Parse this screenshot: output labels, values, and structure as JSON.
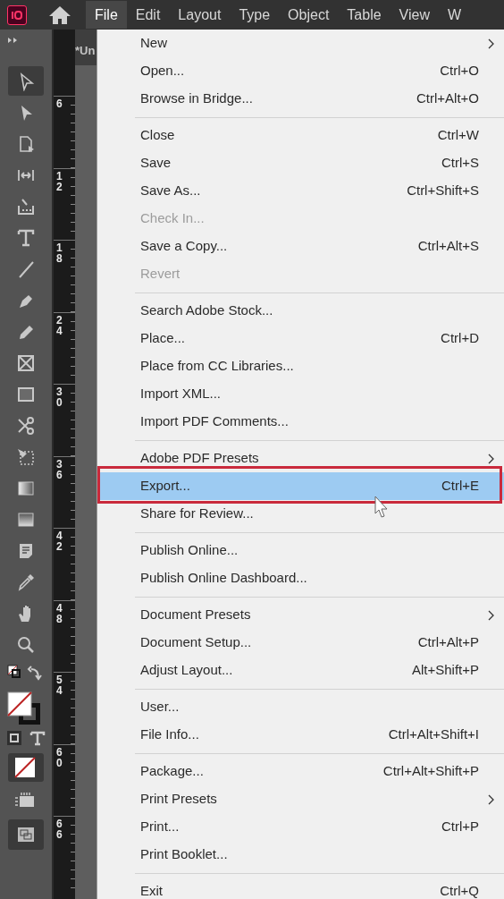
{
  "menubar": {
    "items": [
      {
        "label": "File",
        "selected": true
      },
      {
        "label": "Edit",
        "selected": false
      },
      {
        "label": "Layout",
        "selected": false
      },
      {
        "label": "Type",
        "selected": false
      },
      {
        "label": "Object",
        "selected": false
      },
      {
        "label": "Table",
        "selected": false
      },
      {
        "label": "View",
        "selected": false
      },
      {
        "label": "W",
        "selected": false
      }
    ]
  },
  "document_tab": {
    "title": "*Un"
  },
  "toolbar": {
    "tools": [
      {
        "kind": "selection",
        "selected": true
      },
      {
        "kind": "direct",
        "selected": false
      },
      {
        "kind": "page",
        "selected": false
      },
      {
        "kind": "gap",
        "selected": false
      },
      {
        "kind": "collector",
        "selected": false
      },
      {
        "kind": "type",
        "selected": false
      },
      {
        "kind": "line",
        "selected": false
      },
      {
        "kind": "pen",
        "selected": false
      },
      {
        "kind": "pencil",
        "selected": false
      },
      {
        "kind": "rectframe",
        "selected": false
      },
      {
        "kind": "rectangle",
        "selected": false
      },
      {
        "kind": "scissors",
        "selected": false
      },
      {
        "kind": "transform",
        "selected": false
      },
      {
        "kind": "gradient",
        "selected": false
      },
      {
        "kind": "feather",
        "selected": false
      },
      {
        "kind": "note",
        "selected": false
      },
      {
        "kind": "eyedropper",
        "selected": false
      },
      {
        "kind": "hand",
        "selected": false
      },
      {
        "kind": "zoom",
        "selected": false
      }
    ]
  },
  "ruler": {
    "labels": [
      "6",
      "12",
      "18",
      "24",
      "30",
      "36",
      "42",
      "48",
      "54",
      "60",
      "66"
    ]
  },
  "file_menu": {
    "items": [
      {
        "kind": "item",
        "label": "New",
        "submenu": true
      },
      {
        "kind": "item",
        "label": "Open...",
        "shortcut": "Ctrl+O"
      },
      {
        "kind": "item",
        "label": "Browse in Bridge...",
        "shortcut": "Ctrl+Alt+O"
      },
      {
        "kind": "separator"
      },
      {
        "kind": "item",
        "label": "Close",
        "shortcut": "Ctrl+W"
      },
      {
        "kind": "item",
        "label": "Save",
        "shortcut": "Ctrl+S"
      },
      {
        "kind": "item",
        "label": "Save As...",
        "shortcut": "Ctrl+Shift+S"
      },
      {
        "kind": "item",
        "label": "Check In...",
        "disabled": true
      },
      {
        "kind": "item",
        "label": "Save a Copy...",
        "shortcut": "Ctrl+Alt+S"
      },
      {
        "kind": "item",
        "label": "Revert",
        "disabled": true
      },
      {
        "kind": "separator"
      },
      {
        "kind": "item",
        "label": "Search Adobe Stock..."
      },
      {
        "kind": "item",
        "label": "Place...",
        "shortcut": "Ctrl+D"
      },
      {
        "kind": "item",
        "label": "Place from CC Libraries..."
      },
      {
        "kind": "item",
        "label": "Import XML..."
      },
      {
        "kind": "item",
        "label": "Import PDF Comments..."
      },
      {
        "kind": "separator"
      },
      {
        "kind": "item",
        "label": "Adobe PDF Presets",
        "submenu": true
      },
      {
        "kind": "item",
        "label": "Export...",
        "shortcut": "Ctrl+E",
        "selected": true,
        "outlined": true
      },
      {
        "kind": "item",
        "label": "Share for Review..."
      },
      {
        "kind": "separator"
      },
      {
        "kind": "item",
        "label": "Publish Online..."
      },
      {
        "kind": "item",
        "label": "Publish Online Dashboard..."
      },
      {
        "kind": "separator"
      },
      {
        "kind": "item",
        "label": "Document Presets",
        "submenu": true
      },
      {
        "kind": "item",
        "label": "Document Setup...",
        "shortcut": "Ctrl+Alt+P"
      },
      {
        "kind": "item",
        "label": "Adjust Layout...",
        "shortcut": "Alt+Shift+P"
      },
      {
        "kind": "separator"
      },
      {
        "kind": "item",
        "label": "User..."
      },
      {
        "kind": "item",
        "label": "File Info...",
        "shortcut": "Ctrl+Alt+Shift+I"
      },
      {
        "kind": "separator"
      },
      {
        "kind": "item",
        "label": "Package...",
        "shortcut": "Ctrl+Alt+Shift+P"
      },
      {
        "kind": "item",
        "label": "Print Presets",
        "submenu": true
      },
      {
        "kind": "item",
        "label": "Print...",
        "shortcut": "Ctrl+P"
      },
      {
        "kind": "item",
        "label": "Print Booklet..."
      },
      {
        "kind": "separator"
      },
      {
        "kind": "item",
        "label": "Exit",
        "shortcut": "Ctrl+Q"
      }
    ]
  }
}
